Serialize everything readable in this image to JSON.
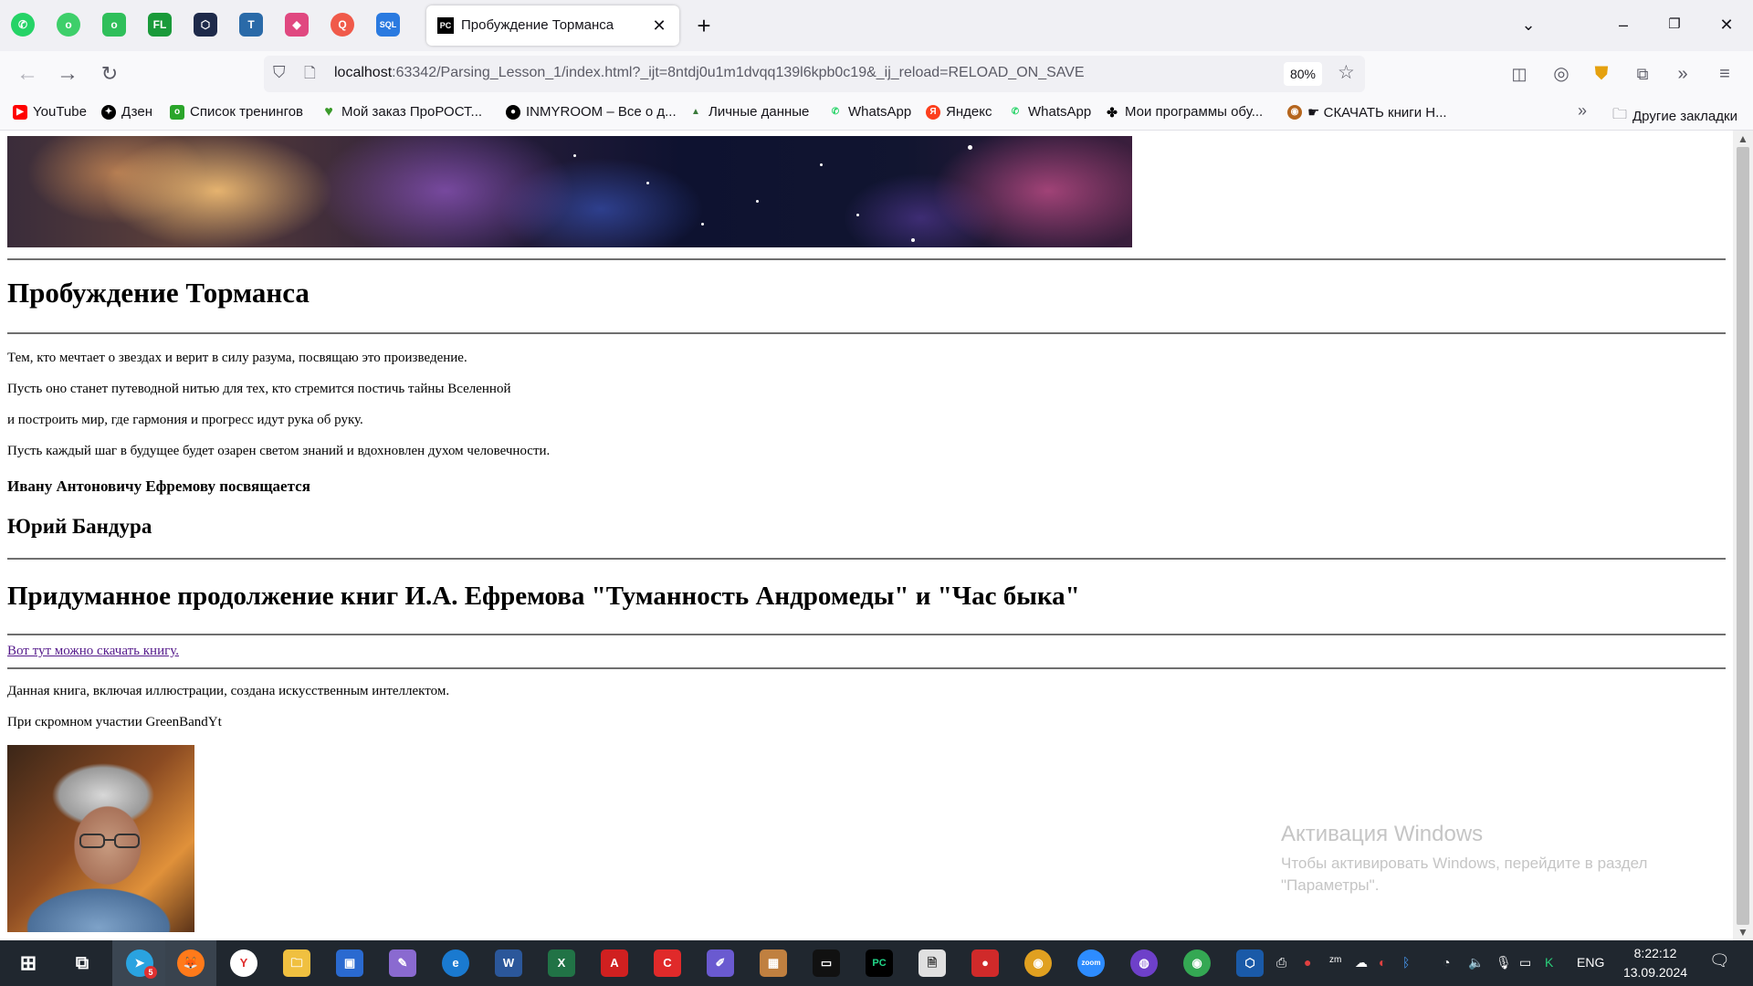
{
  "browser": {
    "tab_title": "Пробуждение Торманса",
    "tab_favicon": "PC",
    "url_host": "localhost",
    "url_rest": ":63342/Parsing_Lesson_1/index.html?_ijt=8ntdj0u1m1dvqq139l6kpb0c19&_ij_reload=RELOAD_ON_SAVE",
    "zoom": "80%",
    "colors": {
      "tabstrip": "#f0f0f4",
      "toolbar": "#f9f9fb",
      "link_visited": "#551a8b"
    }
  },
  "bookmarks": [
    {
      "label": "YouTube",
      "icon": "youtube-icon",
      "color": "#ff0000"
    },
    {
      "label": "Дзен",
      "icon": "zen-icon",
      "color": "#000000"
    },
    {
      "label": "Список тренингов",
      "icon": "training-icon",
      "color": "#2aa52a"
    },
    {
      "label": "Мой заказ ПроРОСТ...",
      "icon": "heart-icon",
      "color": "#3a9a2a"
    },
    {
      "label": "INMYROOM – Все о д...",
      "icon": "inmyroom-icon",
      "color": "#000000"
    },
    {
      "label": "Личные данные",
      "icon": "mountain-icon",
      "color": "#3a7a3a"
    },
    {
      "label": "WhatsApp",
      "icon": "whatsapp-icon",
      "color": "#25d366"
    },
    {
      "label": "Яндекс",
      "icon": "yandex-icon",
      "color": "#fc3f1d"
    },
    {
      "label": "WhatsApp",
      "icon": "whatsapp-icon",
      "color": "#25d366"
    },
    {
      "label": "Мои программы обу...",
      "icon": "programs-icon",
      "color": "#000000"
    },
    {
      "label": "☛ СКАЧАТЬ книги Н...",
      "icon": "books-icon",
      "color": "#b5651d"
    }
  ],
  "other_bookmarks": "Другие закладки",
  "page": {
    "title": "Пробуждение Торманса",
    "dedication_lines": [
      "Тем, кто мечтает о звездах и верит в силу разума, посвящаю это произведение.",
      "Пусть оно станет путеводной нитью для тех, кто стремится постичь тайны Вселенной",
      "и построить мир, где гармония и прогресс идут рука об руку.",
      "Пусть каждый шаг в будущее будет озарен светом знаний и вдохновлен духом человечности."
    ],
    "dedicated_to": "Ивану Антоновичу Ефремову посвящается",
    "author": "Юрий Бандура",
    "subtitle": "Придуманное продолжение книг И.А. Ефремова \"Туманность Андромеды\" и \"Час быка\"",
    "download_link": "Вот тут можно скачать книгу.",
    "ai_note": "Данная книга, включая иллюстрации, создана искусственным интеллектом.",
    "participation": "При скромном участии GreenBandYt"
  },
  "watermark": {
    "title": "Активация Windows",
    "line1": "Чтобы активировать Windows, перейдите в раздел",
    "line2": "\"Параметры\"."
  },
  "taskbar": {
    "language": "ENG",
    "time": "8:22:12",
    "date": "13.09.2024",
    "badge_count": "5",
    "apps": [
      "telegram-icon",
      "firefox-icon",
      "yandex-browser-icon",
      "file-explorer-icon",
      "remote-desktop-icon",
      "paint-icon",
      "edge-icon",
      "word-icon",
      "excel-icon",
      "acrobat-icon",
      "mail-icon",
      "notes-icon",
      "image-icon",
      "terminal-icon",
      "pycharm-icon",
      "documents-icon",
      "video-icon",
      "chrome-icon",
      "zoom-icon",
      "github-icon",
      "chrome-2-icon",
      "virtualbox-icon"
    ]
  }
}
